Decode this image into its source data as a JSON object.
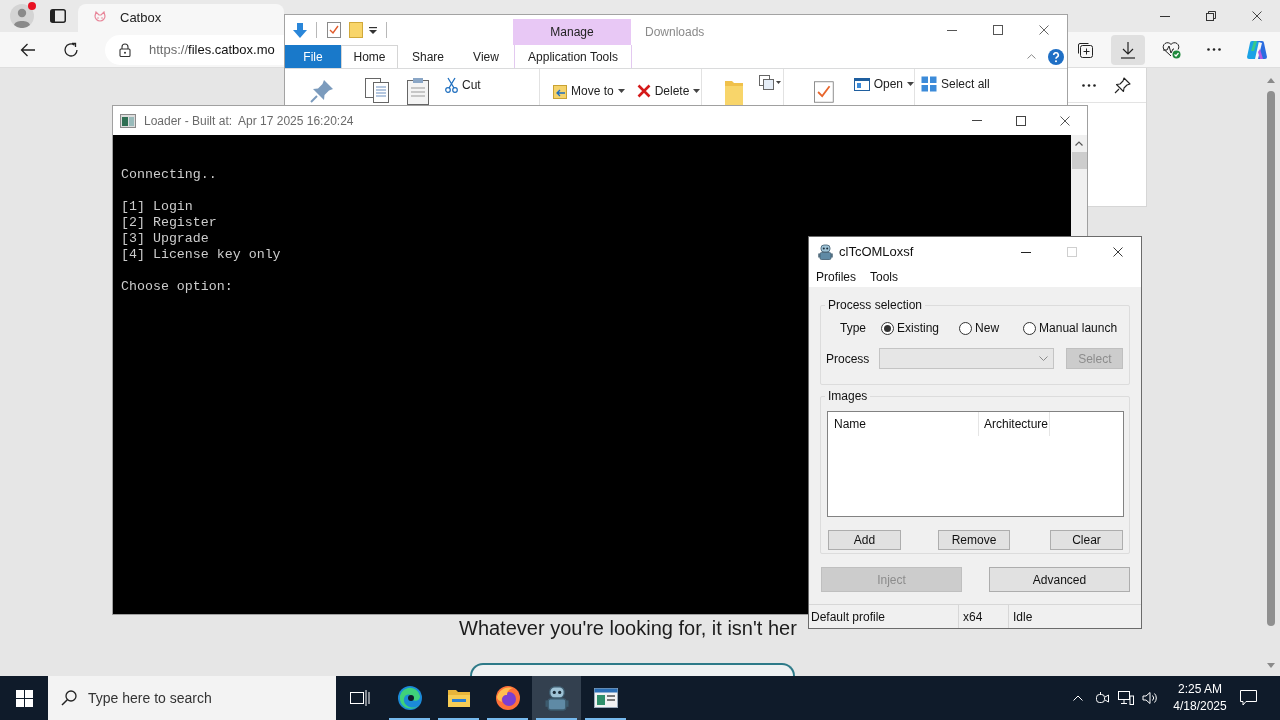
{
  "browser": {
    "tab": {
      "title": "Catbox"
    },
    "address": {
      "scheme": "https://",
      "rest": "files.catbox.mo"
    },
    "toolbar": [
      {
        "kind": "collections",
        "selected": false
      },
      {
        "kind": "downloads",
        "selected": true
      },
      {
        "kind": "health",
        "selected": false
      },
      {
        "kind": "more",
        "selected": false
      },
      {
        "kind": "assistant",
        "selected": false
      }
    ],
    "page": {
      "message": "Whatever you're looking for, it isn't her"
    }
  },
  "explorer": {
    "title": "Downloads",
    "context_label": "Manage",
    "ribbon_tabs": [
      {
        "label": "File",
        "kind": "file",
        "selected": false
      },
      {
        "label": "Home",
        "kind": "tab",
        "selected": true
      },
      {
        "label": "Share",
        "kind": "tab",
        "selected": false
      },
      {
        "label": "View",
        "kind": "tab",
        "selected": false
      },
      {
        "label": "Application Tools",
        "kind": "context",
        "selected": false
      }
    ],
    "commands": [
      {
        "label": "Cut",
        "kind": "cut",
        "dropdown": false
      },
      {
        "label": "Move to",
        "kind": "move",
        "dropdown": true
      },
      {
        "label": "Delete",
        "kind": "delete",
        "dropdown": true
      },
      {
        "label": "Open",
        "kind": "open",
        "dropdown": true
      },
      {
        "label": "Select all",
        "kind": "select",
        "dropdown": false
      }
    ]
  },
  "console": {
    "title": "Loader - Built at:  Apr 17 2025 16:20:24",
    "blocks": [
      [
        "Connecting.."
      ],
      [
        "[1] Login",
        "[2] Register",
        "[3] Upgrade",
        "[4] License key only"
      ],
      [
        "Choose option:"
      ]
    ]
  },
  "injector": {
    "title": "clTcOMLoxsf",
    "maximize_disabled": true,
    "menu": [
      "Profiles",
      "Tools"
    ],
    "process_selection": {
      "legend": "Process selection",
      "type_label": "Type",
      "types": [
        {
          "label": "Existing",
          "selected": true
        },
        {
          "label": "New",
          "selected": false
        },
        {
          "label": "Manual launch",
          "selected": false
        }
      ],
      "process_label": "Process",
      "process_combo": {
        "disabled": true
      },
      "select_button": {
        "label": "Select",
        "disabled": true
      }
    },
    "images": {
      "legend": "Images",
      "columns": [
        "Name",
        "Architecture"
      ],
      "buttons": [
        {
          "label": "Add",
          "disabled": false
        },
        {
          "label": "Remove",
          "disabled": false
        },
        {
          "label": "Clear",
          "disabled": false
        }
      ]
    },
    "actions": [
      {
        "label": "Inject",
        "disabled": true
      },
      {
        "label": "Advanced",
        "disabled": false
      }
    ],
    "status": [
      "Default profile",
      "x64",
      "Idle"
    ]
  },
  "taskbar": {
    "search": {
      "placeholder": "Type here to search"
    },
    "apps": [
      {
        "kind": "browser",
        "selected": false,
        "running": true
      },
      {
        "kind": "files",
        "selected": false,
        "running": true
      },
      {
        "kind": "firefox",
        "selected": false,
        "running": true
      },
      {
        "kind": "robot",
        "selected": true,
        "running": true
      },
      {
        "kind": "console",
        "selected": false,
        "running": true
      }
    ],
    "clock": {
      "time": "2:25 AM",
      "date": "4/18/2025"
    }
  }
}
